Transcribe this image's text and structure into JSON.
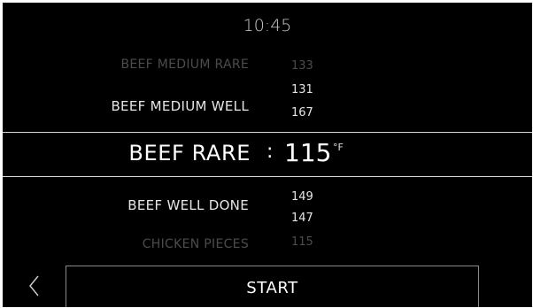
{
  "status": {
    "time": "10:45"
  },
  "picker": {
    "rows": [
      {
        "name": "BEEF MEDIUM RARE",
        "value": "133",
        "style": "faded"
      },
      {
        "name": "",
        "value": "131",
        "style": "dim"
      },
      {
        "name": "BEEF MEDIUM WELL",
        "value": "167",
        "style": "dim"
      },
      {
        "name": "BEEF WELL DONE",
        "value": "149",
        "style": "dim"
      },
      {
        "name": "",
        "value": "147",
        "style": "dim"
      },
      {
        "name": "CHICKEN PIECES",
        "value": "115",
        "style": "faded"
      }
    ],
    "selected": {
      "name": "BEEF RARE",
      "separator": ":",
      "value": "115",
      "unit": "°F"
    }
  },
  "footer": {
    "start_label": "START",
    "back_icon": "chevron-left-icon"
  },
  "colors": {
    "background": "#000000",
    "text": "#ffffff",
    "faded": "#4c4c4c",
    "border": "#8a8a8a"
  }
}
